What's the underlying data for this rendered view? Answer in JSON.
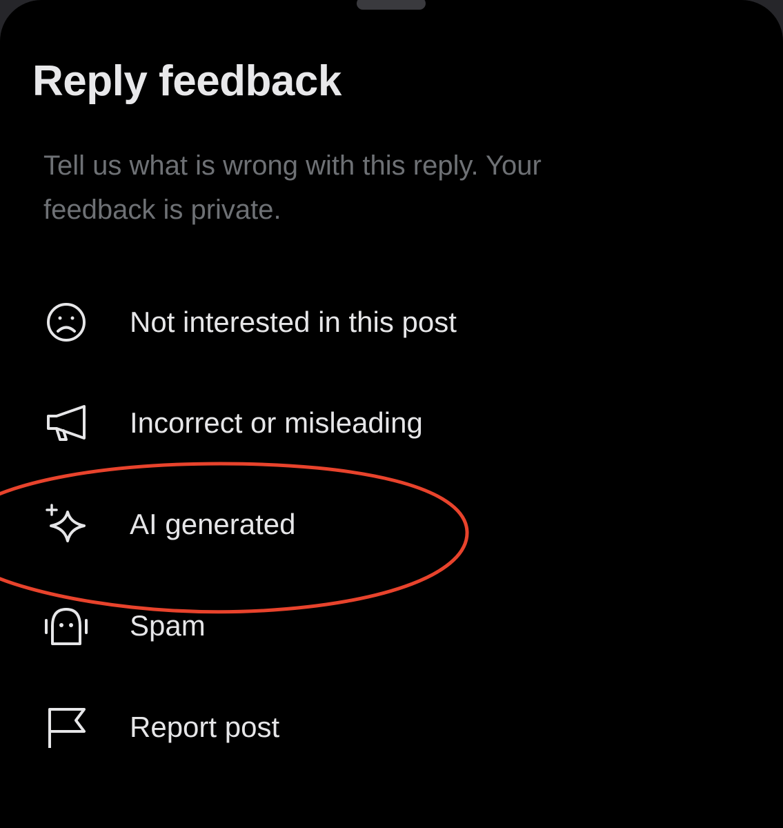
{
  "sheet": {
    "title": "Reply feedback",
    "subtitle": "Tell us what is wrong with this reply. Your feedback is private."
  },
  "options": [
    {
      "label": "Not interested in this post",
      "icon": "frown-face-icon"
    },
    {
      "label": "Incorrect or misleading",
      "icon": "megaphone-icon"
    },
    {
      "label": "AI generated",
      "icon": "sparkle-icon"
    },
    {
      "label": "Spam",
      "icon": "robot-icon"
    },
    {
      "label": "Report post",
      "icon": "flag-icon"
    }
  ],
  "annotation": {
    "shape": "ellipse",
    "color": "#e8432c",
    "highlights": "AI generated"
  },
  "colors": {
    "background": "#000000",
    "text": "#e6e6e8",
    "subtitle": "#6e7175"
  }
}
